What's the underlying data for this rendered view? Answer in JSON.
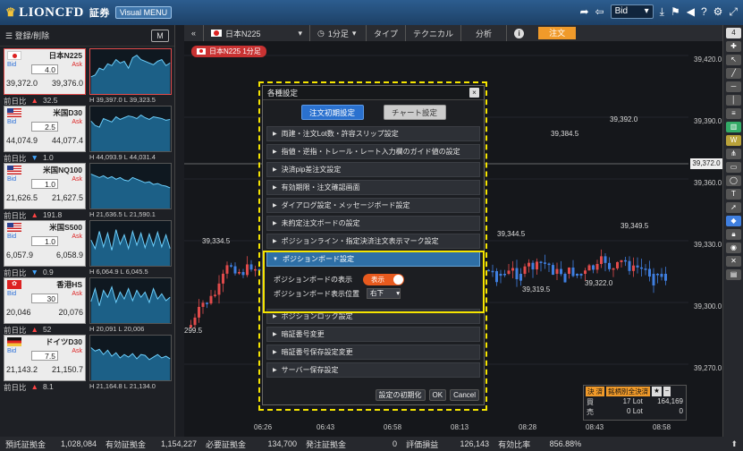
{
  "header": {
    "brand": "LIONCFD",
    "brand_sub": "証券",
    "visual_menu": "Visual MENU",
    "bid_select": "Bid"
  },
  "left_panel": {
    "register_delete": "登録/削除",
    "m_button": "M",
    "tiles": [
      {
        "name": "日本N225",
        "flag": "jp",
        "bid_label": "Bid",
        "ask_label": "Ask",
        "spread": "4.0",
        "bid": "39,372.0",
        "ask": "39,376.0",
        "prev_label": "前日比",
        "dir": "up",
        "change": "32.5",
        "high": "H 39,397.0",
        "low": "L 39,323.5",
        "active": true
      },
      {
        "name": "米国D30",
        "flag": "us",
        "bid_label": "Bid",
        "ask_label": "Ask",
        "spread": "2.5",
        "bid": "44,074.9",
        "ask": "44,077.4",
        "prev_label": "前日比",
        "dir": "dn",
        "change": "1.0",
        "high": "H 44,093.9",
        "low": "L 44,031.4",
        "active": false
      },
      {
        "name": "米国NQ100",
        "flag": "us",
        "bid_label": "Bid",
        "ask_label": "Ask",
        "spread": "1.0",
        "bid": "21,626.5",
        "ask": "21,627.5",
        "prev_label": "前日比",
        "dir": "up",
        "change": "191.8",
        "high": "H 21,636.5",
        "low": "L 21,590.1",
        "active": false
      },
      {
        "name": "米国S500",
        "flag": "us",
        "bid_label": "Bid",
        "ask_label": "Ask",
        "spread": "1.0",
        "bid": "6,057.9",
        "ask": "6,058.9",
        "prev_label": "前日比",
        "dir": "dn",
        "change": "0.9",
        "high": "H 6,064.9",
        "low": "L 6,045.5",
        "active": false
      },
      {
        "name": "香港HS",
        "flag": "hk",
        "bid_label": "Bid",
        "ask_label": "Ask",
        "spread": "30",
        "bid": "20,046",
        "ask": "20,076",
        "prev_label": "前日比",
        "dir": "up",
        "change": "52",
        "high": "H 20,091",
        "low": "L 20,006",
        "active": false
      },
      {
        "name": "ドイツD30",
        "flag": "de",
        "bid_label": "Bid",
        "ask_label": "Ask",
        "spread": "7.5",
        "bid": "21,143.2",
        "ask": "21,150.7",
        "prev_label": "前日比",
        "dir": "up",
        "change": "8.1",
        "high": "H 21,164.8",
        "low": "L 21,134.0",
        "active": false
      }
    ]
  },
  "chart_toolbar": {
    "symbol": "日本N225",
    "timeframe": "1分足",
    "type": "タイプ",
    "technical": "テクニカル",
    "analysis": "分析",
    "info": "i",
    "order": "注文",
    "chart_label": "日本N225 1分足"
  },
  "chart": {
    "y_ticks": [
      "39,420.0",
      "39,390.0",
      "39,360.0",
      "39,330.0",
      "39,300.0",
      "39,270.0"
    ],
    "current_price": "39,372.0",
    "x_ticks": [
      "06:26",
      "06:43",
      "06:58",
      "08:13",
      "08:28",
      "08:43",
      "08:58"
    ],
    "annotations": [
      "39,392.0",
      "39,384.5",
      "39,334.5",
      "39,344.5",
      "39,349.5",
      "39,319.5",
      "39,322.0",
      "299.5"
    ]
  },
  "dialog": {
    "title": "各種設定",
    "close": "×",
    "tab_order": "注文初期設定",
    "tab_chart": "チャート設定",
    "sections_before": [
      "両建・注文Lot数・許容スリップ設定",
      "指値・逆指・トレール・レート入力欄のガイド値の設定",
      "決済pip差注文設定",
      "有効期限・注文確認画面",
      "ダイアログ設定・メッセージボード設定",
      "未約定注文ボードの設定",
      "ポジションライン・指定決済注文表示マーク設定"
    ],
    "open_section": "ポジションボード設定",
    "show_label": "ポジションボードの表示",
    "show_toggle": "表示",
    "position_label": "ポジションボード表示位置",
    "position_value": "右下",
    "sections_after": [
      "ポジションロック設定",
      "暗証番号変更",
      "暗証番号保存設定変更",
      "サーバー保存設定"
    ],
    "btn_reset": "設定の初期化",
    "btn_ok": "OK",
    "btn_cancel": "Cancel"
  },
  "position_panel": {
    "settle": "決 済",
    "by_symbol": "銘柄別全決済",
    "buy_label": "買",
    "buy_lot": "17 Lot",
    "buy_value": "164,169",
    "sell_label": "売",
    "sell_lot": "0 Lot",
    "sell_value": "0"
  },
  "footer": [
    {
      "label": "預託証拠金",
      "value": "1,028,084"
    },
    {
      "label": "有効証拠金",
      "value": "1,154,227"
    },
    {
      "label": "必要証拠金",
      "value": "134,700"
    },
    {
      "label": "発注証拠金",
      "value": "0"
    },
    {
      "label": "評価損益",
      "value": "126,143"
    },
    {
      "label": "有効比率",
      "value": "856.88%"
    }
  ],
  "colors": {
    "accent": "#f09a2a",
    "up": "#e24b4b",
    "down": "#3f7fe0",
    "highlight": "#f5e400"
  }
}
